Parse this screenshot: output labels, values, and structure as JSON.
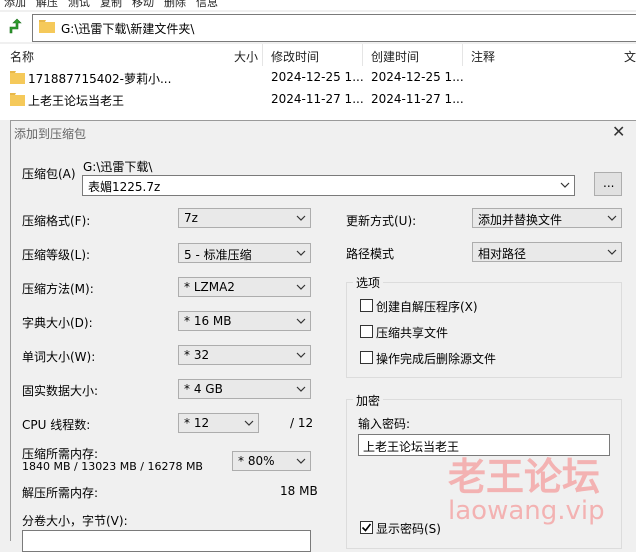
{
  "toolbar": {
    "items": [
      "添加",
      "解压",
      "测试",
      "复制",
      "移动",
      "删除",
      "信息"
    ]
  },
  "address": {
    "path": "G:\\迅雷下载\\新建文件夹\\"
  },
  "file_list": {
    "columns": [
      "名称",
      "大小",
      "修改时间",
      "创建时间",
      "注释",
      "文"
    ],
    "rows": [
      {
        "name": "171887715402-萝莉小...",
        "size": "",
        "modified": "2024-12-25 1...",
        "created": "2024-12-25 1..."
      },
      {
        "name": "上老王论坛当老王",
        "size": "",
        "modified": "2024-11-27 1...",
        "created": "2024-11-27 1..."
      }
    ]
  },
  "dialog": {
    "title": "添加到压缩包",
    "archive_label": "压缩包(A)",
    "archive_dir": "G:\\迅雷下载\\",
    "archive_name": "表媚1225.7z",
    "browse_label": "...",
    "format_label": "压缩格式(F):",
    "format_value": "7z",
    "level_label": "压缩等级(L):",
    "level_value": "5 - 标准压缩",
    "method_label": "压缩方法(M):",
    "method_value": "*  LZMA2",
    "dict_label": "字典大小(D):",
    "dict_value": "*  16 MB",
    "word_label": "单词大小(W):",
    "word_value": "*  32",
    "solid_label": "固实数据大小:",
    "solid_value": "*  4 GB",
    "cpu_label": "CPU 线程数:",
    "cpu_value": "*  12",
    "cpu_total": "/ 12",
    "mem_comp_label": "压缩所需内存:",
    "mem_comp_value": "1840 MB / 13023 MB / 16278 MB",
    "mem_pct_value": "*  80%",
    "mem_decomp_label": "解压所需内存:",
    "mem_decomp_value": "18 MB",
    "split_label": "分卷大小，字节(V):",
    "update_label": "更新方式(U):",
    "update_value": "添加并替换文件",
    "pathmode_label": "路径模式",
    "pathmode_value": "相对路径",
    "options_title": "选项",
    "opt_sfx": "创建自解压程序(X)",
    "opt_shared": "压缩共享文件",
    "opt_delete": "操作完成后删除源文件",
    "encryption_title": "加密",
    "password_label": "输入密码:",
    "password_value": "上老王论坛当老王",
    "show_password_label": "显示密码(S)",
    "show_password_checked": true
  },
  "watermark": {
    "line1": "老王论坛",
    "line2": "laowang.vip"
  }
}
